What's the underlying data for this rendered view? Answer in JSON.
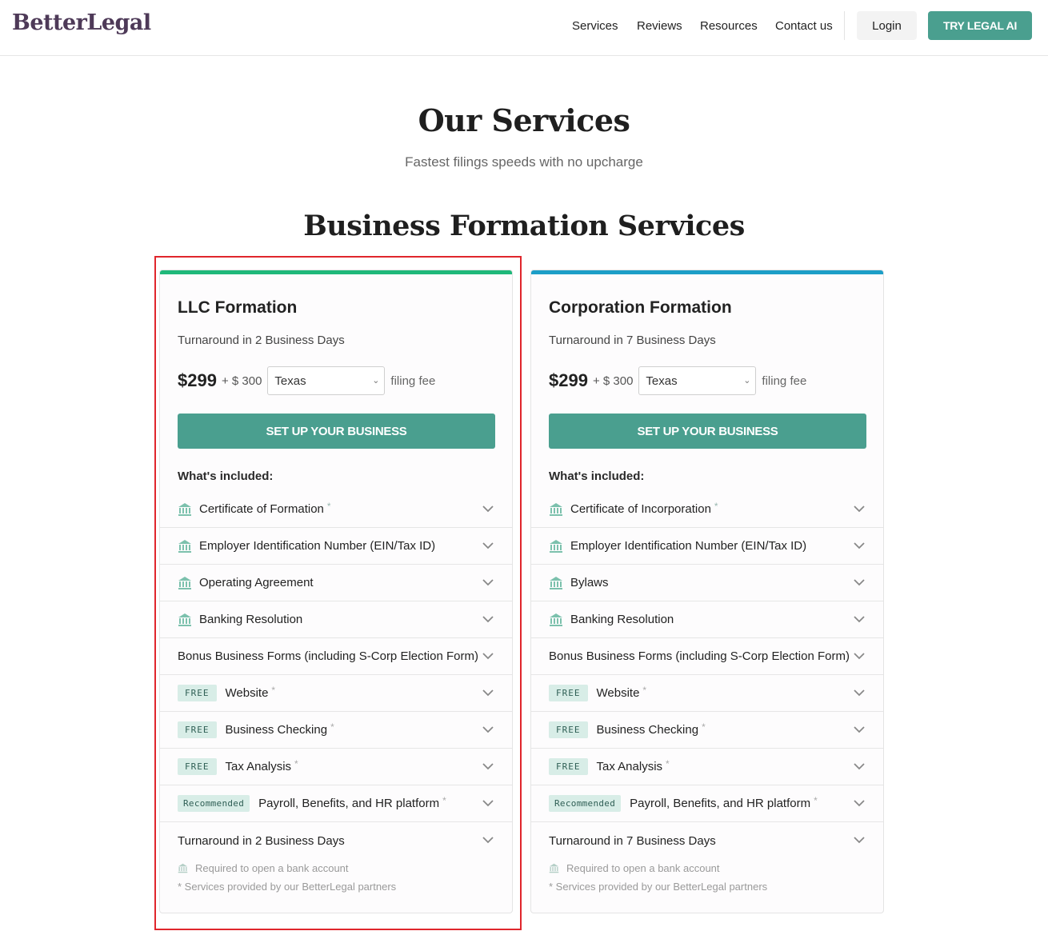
{
  "header": {
    "logo": "BetterLegal",
    "nav": [
      "Services",
      "Reviews",
      "Resources",
      "Contact us"
    ],
    "login": "Login",
    "cta": "TRY LEGAL AI"
  },
  "hero": {
    "title": "Our Services",
    "subtitle": "Fastest filings speeds with no upcharge"
  },
  "section_title": "Business Formation Services",
  "colors": {
    "accent": "#4a9f8f",
    "llc_bar": "#1fb87a",
    "corp_bar": "#1c9ec7",
    "highlight": "#e0262c",
    "icon": "#7cc1ad"
  },
  "cards": [
    {
      "title": "LLC Formation",
      "turnaround": "Turnaround in 2 Business Days",
      "price": "$299",
      "plus_fee": "+ $ 300",
      "state": "Texas",
      "fee_label": "filing fee",
      "cta": "SET UP YOUR BUSINESS",
      "included_label": "What's included:",
      "items": [
        {
          "icon": "bank-icon",
          "tag": "",
          "label": "Certificate of Formation",
          "star": "*"
        },
        {
          "icon": "bank-icon",
          "tag": "",
          "label": "Employer Identification Number (EIN/Tax ID)",
          "star": ""
        },
        {
          "icon": "bank-icon",
          "tag": "",
          "label": "Operating Agreement",
          "star": ""
        },
        {
          "icon": "bank-icon",
          "tag": "",
          "label": "Banking Resolution",
          "star": ""
        },
        {
          "icon": "",
          "tag": "",
          "label": "Bonus Business Forms (including S-Corp Election Form)",
          "star": ""
        },
        {
          "icon": "",
          "tag": "FREE",
          "label": "Website",
          "star": "*"
        },
        {
          "icon": "",
          "tag": "FREE",
          "label": "Business Checking",
          "star": "*"
        },
        {
          "icon": "",
          "tag": "FREE",
          "label": "Tax Analysis",
          "star": "*"
        },
        {
          "icon": "",
          "tag": "Recommended",
          "label": "Payroll, Benefits, and HR platform",
          "star": "*"
        },
        {
          "icon": "",
          "tag": "",
          "label": "Turnaround in 2 Business Days",
          "star": ""
        }
      ],
      "legend": "Required to open a bank account",
      "note": "* Services provided by our BetterLegal partners"
    },
    {
      "title": "Corporation Formation",
      "turnaround": "Turnaround in 7 Business Days",
      "price": "$299",
      "plus_fee": "+ $ 300",
      "state": "Texas",
      "fee_label": "filing fee",
      "cta": "SET UP YOUR BUSINESS",
      "included_label": "What's included:",
      "items": [
        {
          "icon": "bank-icon",
          "tag": "",
          "label": "Certificate of Incorporation",
          "star": "*"
        },
        {
          "icon": "bank-icon",
          "tag": "",
          "label": "Employer Identification Number (EIN/Tax ID)",
          "star": ""
        },
        {
          "icon": "bank-icon",
          "tag": "",
          "label": "Bylaws",
          "star": ""
        },
        {
          "icon": "bank-icon",
          "tag": "",
          "label": "Banking Resolution",
          "star": ""
        },
        {
          "icon": "",
          "tag": "",
          "label": "Bonus Business Forms (including S-Corp Election Form)",
          "star": ""
        },
        {
          "icon": "",
          "tag": "FREE",
          "label": "Website",
          "star": "*"
        },
        {
          "icon": "",
          "tag": "FREE",
          "label": "Business Checking",
          "star": "*"
        },
        {
          "icon": "",
          "tag": "FREE",
          "label": "Tax Analysis",
          "star": "*"
        },
        {
          "icon": "",
          "tag": "Recommended",
          "label": "Payroll, Benefits, and HR platform",
          "star": "*"
        },
        {
          "icon": "",
          "tag": "",
          "label": "Turnaround in 7 Business Days",
          "star": ""
        }
      ],
      "legend": "Required to open a bank account",
      "note": "* Services provided by our BetterLegal partners"
    }
  ]
}
